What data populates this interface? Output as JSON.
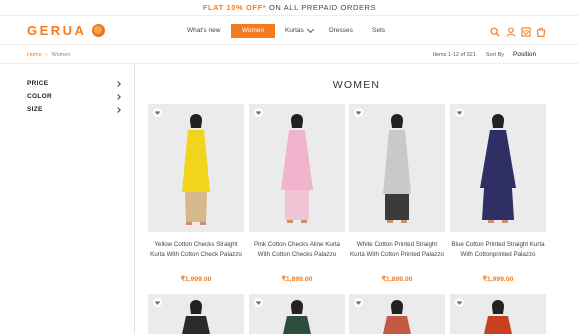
{
  "promo": {
    "highlight": "FLAT 10% OFF*",
    "rest": " ON ALL PREPAID ORDERS"
  },
  "header": {
    "logo": "GERUA",
    "nav": {
      "whats_new": "What's new",
      "women": "Women",
      "kurtas": "Kurtas",
      "dresses": "Dresses",
      "sets": "Sets"
    }
  },
  "breadcrumb": {
    "home": "Home",
    "current": "Women"
  },
  "toolbar": {
    "items_count": "Items 1-12 of 321",
    "sort_label": "Sort By",
    "sort_value": "Position"
  },
  "filters": [
    "PRICE",
    "COLOR",
    "SIZE"
  ],
  "page_title": "WOMEN",
  "colors": {
    "accent": "#f47c20"
  },
  "products": [
    {
      "name": "Yellow Cotton Checks Straight Kurta With Cotton Check Palazzo",
      "price": "₹1,999.00",
      "color": "#f2d41c",
      "bottom": "#d6b98a"
    },
    {
      "name": "Pink Cotton Checks Aline Kurta With Cotton Checks Palazzo",
      "price": "₹1,899.00",
      "color": "#f2b4cc",
      "bottom": "#f0c4d4"
    },
    {
      "name": "White Cotton Printed Straight Kurta With Cotton Printed Palazzo",
      "price": "₹1,899.00",
      "color": "#c9c9c9",
      "bottom": "#3a3a3a"
    },
    {
      "name": "Blue Cotton Printed Straight Kurta With Cottonprinted Palazzo",
      "price": "₹1,999.00",
      "color": "#2f2f66",
      "bottom": "#2f2f66"
    }
  ],
  "row2_products": [
    {
      "color": "#2a2a2a"
    },
    {
      "color": "#2c4e3a"
    },
    {
      "color": "#c45a45"
    },
    {
      "color": "#c8401f"
    }
  ]
}
